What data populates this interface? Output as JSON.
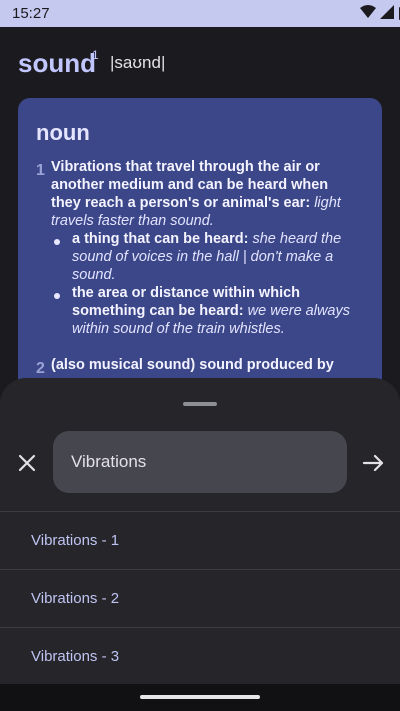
{
  "status_bar": {
    "time": "15:27",
    "icons": [
      "wifi-icon",
      "signal-icon",
      "battery-icon"
    ]
  },
  "entry": {
    "word": "sound",
    "superscript": "1",
    "pronunciation": "|saʊnd|"
  },
  "definition_card": {
    "part_of_speech": "noun",
    "senses": [
      {
        "number": "1",
        "definition": "Vibrations that travel through the air or another medium and can be heard when they reach a person's or animal's ear:",
        "example": "light travels faster than sound.",
        "subsenses": [
          {
            "definition": "a thing that can be heard:",
            "example": "she heard the sound of voices in the hall | don't make a sound."
          },
          {
            "definition": "the area or distance within which something can be heard:",
            "example": "we were always within sound of the train whistles."
          }
        ]
      },
      {
        "number": "2",
        "definition": "(also musical sound) sound produced by"
      }
    ]
  },
  "search_sheet": {
    "query": "Vibrations",
    "results": [
      "Vibrations - 1",
      "Vibrations - 2",
      "Vibrations - 3"
    ]
  },
  "colors": {
    "accent": "#c2c6ff",
    "card": "#3b4788",
    "sheet": "#25252a",
    "status_bar": "#c5c8ef"
  }
}
